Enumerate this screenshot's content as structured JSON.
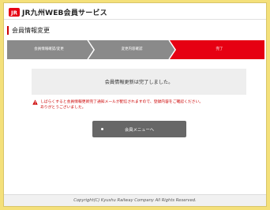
{
  "header": {
    "logo_text": "JR",
    "brand_name": "JR九州WEB会員サービス"
  },
  "page": {
    "title": "会員情報変更"
  },
  "steps": [
    {
      "label": "会員情報確認/変更",
      "state": "done"
    },
    {
      "label": "変更内容確認",
      "state": "done"
    },
    {
      "label": "完了",
      "state": "current"
    }
  ],
  "message": {
    "text": "会員情報更新は完了しました。"
  },
  "notice": {
    "icon": "warning-icon",
    "lines": [
      "しばらくすると会員情報更新完了通知メールが配信されますので、登録内容をご確認ください。",
      "ありがとうございました。"
    ]
  },
  "actions": {
    "member_menu_label": "会員メニューへ"
  },
  "footer": {
    "copyright": "Copyright(C) Kyushu Railway Company All Rights Reserved."
  },
  "colors": {
    "accent": "#cc0000",
    "step_done": "#8a8a8a",
    "step_current": "#e60012",
    "background": "#f4e07a",
    "button": "#676767"
  }
}
